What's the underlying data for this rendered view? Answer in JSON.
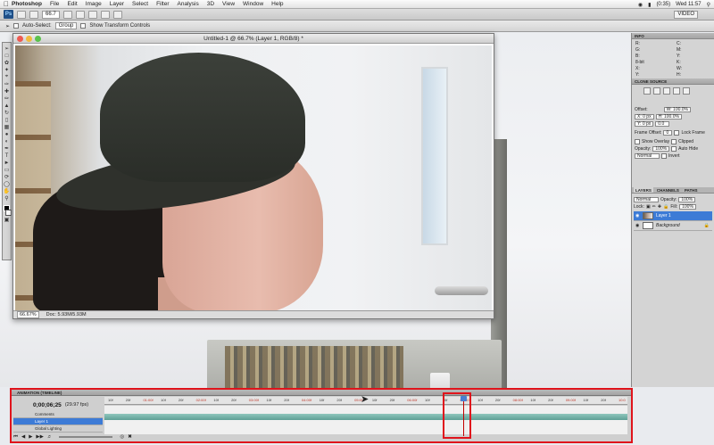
{
  "menubar": {
    "app_name": "Photoshop",
    "items": [
      "File",
      "Edit",
      "Image",
      "Layer",
      "Select",
      "Filter",
      "Analysis",
      "3D",
      "View",
      "Window",
      "Help"
    ],
    "battery": "(0:35)",
    "clock": "Wed 11:57"
  },
  "appbar": {
    "logo": "Ps",
    "zoom": "66.7",
    "workspace": "VIDEO"
  },
  "options": {
    "auto_select_label": "Auto-Select:",
    "auto_select_value": "Group",
    "transform_label": "Show Transform Controls"
  },
  "document": {
    "title": "Untitled-1 @ 66.7% (Layer 1, RGB/8) *",
    "zoom": "66.67%",
    "doc_size": "Doc: 5.93M/5.93M"
  },
  "panels": {
    "info": {
      "header": "INFO",
      "rows": [
        "R:",
        "C:",
        "G:",
        "M:",
        "B:",
        "Y:",
        "8-bit",
        "K:",
        "X:",
        "W:",
        "Y:",
        "H:"
      ]
    },
    "clone_source": {
      "header": "CLONE SOURCE",
      "offset_label": "Offset:",
      "w": "W: 100.0%",
      "h": "H: 100.0%",
      "x": "X: 0 px",
      "y": "Y: 0 px",
      "angle": "0.0",
      "frame_offset_label": "Frame Offset:",
      "frame_offset": "0",
      "lock_frame": "Lock Frame",
      "show_overlay": "Show Overlay",
      "clipped": "Clipped",
      "opacity_label": "Opacity:",
      "opacity": "100%",
      "auto_hide": "Auto Hide",
      "blend_mode": "Normal",
      "invert": "Invert"
    },
    "layers": {
      "tabs": [
        "LAYERS",
        "CHANNELS",
        "PATHS"
      ],
      "blend": "Normal",
      "opacity_label": "Opacity:",
      "opacity": "100%",
      "lock_label": "Lock:",
      "fill_label": "Fill:",
      "fill": "100%",
      "rows": [
        {
          "name": "Layer 1",
          "selected": true
        },
        {
          "name": "Background",
          "selected": false
        }
      ]
    }
  },
  "timeline": {
    "header": "ANIMATION (TIMELINE)",
    "timecode": "0;00;06;25",
    "fps": "(29.97 fps)",
    "tracks": [
      "Comments",
      "Layer 1",
      "Global Lighting"
    ],
    "ticks": [
      "10f",
      "20f",
      "01:00f",
      "10f",
      "20f",
      "02:00f",
      "10f",
      "20f",
      "03:00f",
      "10f",
      "20f",
      "04:00f",
      "10f",
      "20f",
      "05:00f",
      "10f",
      "20f",
      "06:00f",
      "10f",
      "20f",
      "07:00",
      "10f",
      "20f",
      "08:00f",
      "10f",
      "20f",
      "09:00f",
      "10f",
      "20f",
      "10:0"
    ],
    "playhead_fraction": 0.686
  },
  "colors": {
    "callout_red": "#e0141c",
    "selection_blue": "#3d7bd6",
    "track_teal": "#6aa89e"
  }
}
